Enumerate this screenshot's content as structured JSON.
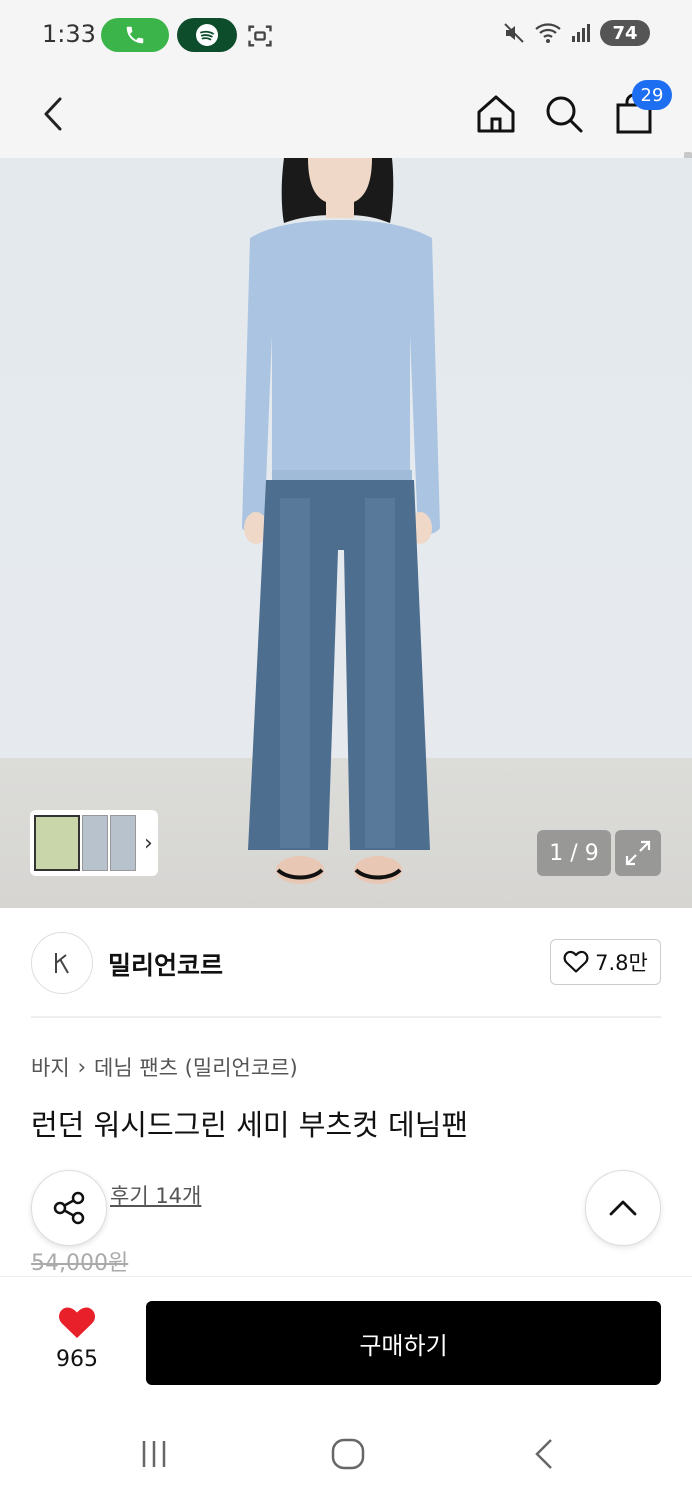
{
  "status_bar": {
    "time": "1:33",
    "battery": "74"
  },
  "nav": {
    "cart_count": "29"
  },
  "gallery": {
    "page_indicator": "1 / 9"
  },
  "brand": {
    "name": "밀리언코르",
    "likes": "7.8만"
  },
  "product": {
    "breadcrumb": [
      "바지",
      "데님 팬츠 (밀리언코르)"
    ],
    "title": "런던 워시드그린 세미 부츠컷 데님팬",
    "review_link": "후기 14개",
    "original_price": "54,000원"
  },
  "bottom_bar": {
    "wish_count": "965",
    "buy_label": "구매하기"
  },
  "colors": {
    "accent_blue": "#1d6ef0",
    "call_green": "#3bb54a",
    "music_green": "#0d4d2c",
    "heart_red": "#e8202a",
    "buy_black": "#000000"
  }
}
